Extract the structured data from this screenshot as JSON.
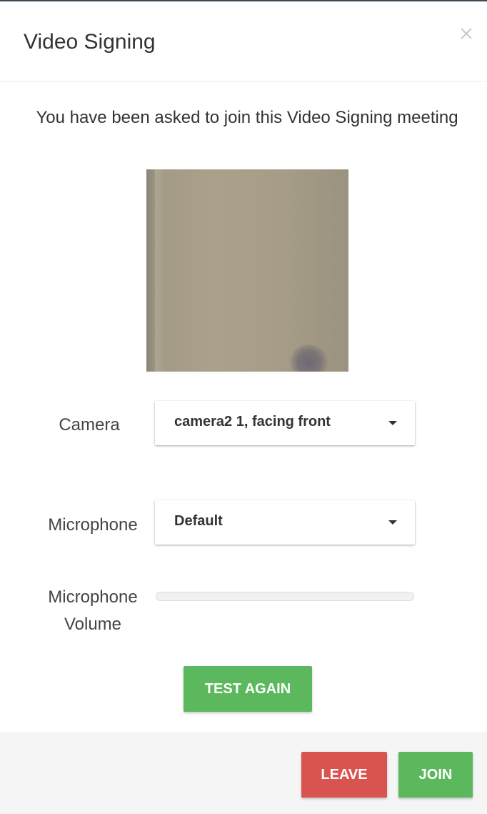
{
  "dialog": {
    "title": "Video Signing",
    "close_icon": "close-icon"
  },
  "prompt": "You have been asked to join this Video Signing meeting",
  "camera": {
    "label": "Camera",
    "selected": "camera2 1, facing front"
  },
  "microphone": {
    "label": "Microphone",
    "selected": "Default"
  },
  "volume": {
    "label": "Microphone Volume",
    "level_percent": 0
  },
  "buttons": {
    "test_again": "TEST AGAIN",
    "leave": "LEAVE",
    "join": "JOIN"
  },
  "colors": {
    "success": "#5cb85c",
    "danger": "#d9534f",
    "footer_bg": "#f5f5f5"
  }
}
